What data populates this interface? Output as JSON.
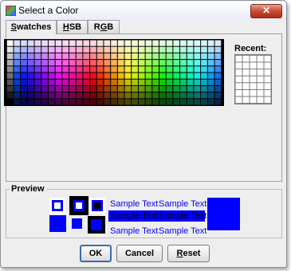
{
  "window": {
    "title": "Select a Color",
    "close_symbol": "✕"
  },
  "tabs": [
    {
      "label": "Swatches",
      "active": true
    },
    {
      "label": "HSB",
      "active": false
    },
    {
      "label": "RGB",
      "active": false
    }
  ],
  "swatches": {
    "rows": 10,
    "cols": 31
  },
  "recent": {
    "label": "Recent:",
    "rows": 7,
    "cols": 5,
    "color": "#ffffff"
  },
  "preview": {
    "title": "Preview",
    "color": "#0000ff",
    "sample_text": "Sample Text"
  },
  "buttons": {
    "ok": "OK",
    "cancel": "Cancel",
    "reset": "Reset"
  },
  "colors": {
    "selected": "#0000ff",
    "panel_bg": "#eeeeee",
    "default_button_border": "#3a6bb0"
  }
}
